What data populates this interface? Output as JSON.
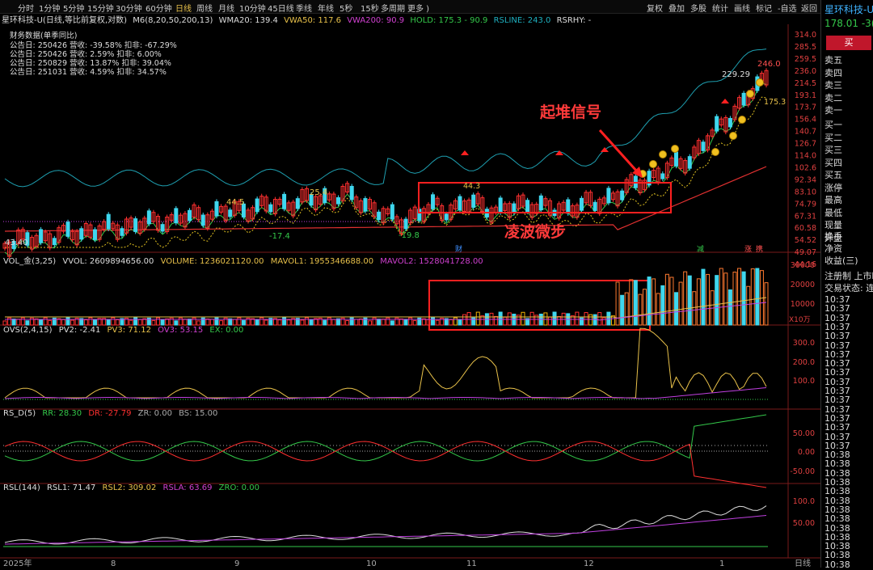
{
  "toolbar": {
    "periods": [
      "分时",
      "1分钟",
      "5分钟",
      "15分钟",
      "30分钟",
      "60分钟",
      "日线",
      "周线",
      "月线",
      "10分钟",
      "45日线",
      "季线",
      "年线",
      "5秒",
      "15秒",
      "多周期",
      "更多 )"
    ],
    "active_period": "日线",
    "right_tools": [
      "复权",
      "叠加",
      "多股",
      "统计",
      "画线",
      "标记",
      "-自选",
      "返回"
    ]
  },
  "title_line": {
    "stock": "星环科技-U(日线,等比前复权,对数)",
    "m6": "M6(8,20,50,200,13)",
    "wma20": "WMA20: 139.4",
    "vwa50": "VWA50: 117.6",
    "vwa200": "VWA200: 90.9",
    "hold": "HOLD: 175.3 - 90.9",
    "rsline": "RSLINE: 243.0",
    "rsrhy": "RSRHY: -"
  },
  "finance": {
    "title": "财务数据(单季同比)",
    "rows": [
      "公告日: 250426   营收: -39.58%   扣非: -67.29%",
      "公告日: 250426   营收: 2.59%   扣非: 6.00%",
      "公告日: 250829   营收: 13.87%   扣非: 39.04%",
      "公告日: 251031   营收: 4.59%   扣非: 34.57%"
    ]
  },
  "annotations": {
    "signal": "起堆信号",
    "wave": "凌波微步",
    "high_label": "246.0",
    "prev_high": "229.29",
    "last_price": "175.3",
    "marks": [
      "44.5",
      "25.4",
      "44.3",
      "-17.4",
      "-19.8",
      "43.40"
    ],
    "tags": [
      "财",
      "减",
      "涨",
      "携"
    ]
  },
  "price_axis": [
    "314.0",
    "285.5",
    "259.5",
    "236.0",
    "214.5",
    "193.1",
    "173.7",
    "156.4",
    "140.7",
    "126.7",
    "114.0",
    "102.6",
    "92.34",
    "83.10",
    "74.79",
    "67.31",
    "60.58",
    "54.52",
    "49.07",
    "44.16"
  ],
  "volume": {
    "title": "VOL_金(3,25)",
    "vvol": "VVOL: 2609894656.00",
    "volume": "VOLUME: 1236021120.00",
    "mavol1": "MAVOL1: 1955346688.00",
    "mavol2": "MAVOL2: 1528041728.00",
    "axis": [
      "30000",
      "20000",
      "10000"
    ],
    "unit": "X10万"
  },
  "ovs": {
    "title": "OVS(2,4,15)",
    "pv2": "PV2: -2.41",
    "pv3": "PV3: 71.12",
    "ov3": "OV3: 53.15",
    "ex": "EX: 0.00",
    "axis": [
      "300.0",
      "200.0",
      "100.0"
    ]
  },
  "rsd": {
    "title": "RS_D(5)",
    "rr": "RR: 28.30",
    "dr": "DR: -27.79",
    "zr": "ZR: 0.00",
    "bs": "BS: 15.00",
    "axis": [
      "50.00",
      "0.00",
      "-50.00"
    ]
  },
  "rsl": {
    "title": "RSL(144)",
    "rsl1": "RSL1: 71.47",
    "rsl2": "RSL2: 309.02",
    "rsla": "RSLA: 63.69",
    "zro": "ZRO: 0.00",
    "axis": [
      "100.0",
      "50.00"
    ]
  },
  "x_axis": {
    "labels": [
      "2025年",
      "8",
      "9",
      "10",
      "11",
      "12",
      "1"
    ],
    "period": "日线"
  },
  "quote_panel": {
    "name": "星环科技-U",
    "price": "178.01",
    "change": "-3(",
    "buy_label": "买",
    "ask": [
      "卖五",
      "卖四",
      "卖三",
      "卖二",
      "卖一"
    ],
    "bid": [
      "买一",
      "买二",
      "买三",
      "买四",
      "买五"
    ],
    "fields": [
      "涨停",
      "最高",
      "最低",
      "现量",
      "外盘"
    ],
    "fields2": [
      "换手",
      "净资",
      "收益(三)"
    ],
    "reg": "注册制 上市时",
    "status": "交易状态: 连续",
    "ticks": [
      "10:37",
      "10:37",
      "10:37",
      "10:37",
      "10:37",
      "10:37",
      "10:37",
      "10:37",
      "10:37",
      "10:37",
      "10:37",
      "10:37",
      "10:37",
      "10:37",
      "10:37",
      "10:37",
      "10:37",
      "10:38",
      "10:38",
      "10:38",
      "10:38",
      "10:38",
      "10:38",
      "10:38",
      "10:38",
      "10:38",
      "10:38",
      "10:38",
      "10:38",
      "10:38"
    ]
  },
  "colors": {
    "up": "#ff3030",
    "down": "#3fd7ee",
    "accent": "#e8c14a",
    "ma_cyan": "#1e9fb0",
    "ma_green": "#34c84a",
    "ma_yellow": "#e0c020",
    "ma_red": "#e03030",
    "purple": "#c040e0"
  }
}
